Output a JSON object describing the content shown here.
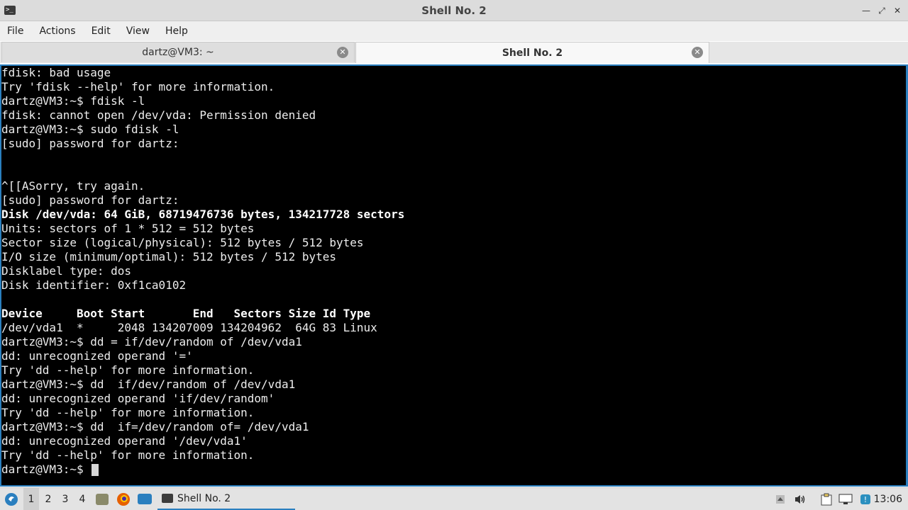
{
  "window": {
    "title": "Shell No. 2",
    "icons": {
      "app": "terminal-icon",
      "minimize": "minimize-icon",
      "maximize": "maximize-icon",
      "close": "close-icon"
    }
  },
  "menu": {
    "items": [
      "File",
      "Actions",
      "Edit",
      "View",
      "Help"
    ]
  },
  "tabs": [
    {
      "label": "dartz@VM3: ~"
    },
    {
      "label": "Shell No. 2"
    }
  ],
  "terminal": {
    "lines": [
      {
        "text": "fdisk: bad usage",
        "bold": false
      },
      {
        "text": "Try 'fdisk --help' for more information.",
        "bold": false
      },
      {
        "text": "dartz@VM3:~$ fdisk -l",
        "bold": false
      },
      {
        "text": "fdisk: cannot open /dev/vda: Permission denied",
        "bold": false
      },
      {
        "text": "dartz@VM3:~$ sudo fdisk -l",
        "bold": false
      },
      {
        "text": "[sudo] password for dartz:",
        "bold": false
      },
      {
        "text": "",
        "bold": false
      },
      {
        "text": "",
        "bold": false
      },
      {
        "text": "^[[ASorry, try again.",
        "bold": false
      },
      {
        "text": "[sudo] password for dartz:",
        "bold": false
      },
      {
        "text": "Disk /dev/vda: 64 GiB, 68719476736 bytes, 134217728 sectors",
        "bold": true
      },
      {
        "text": "Units: sectors of 1 * 512 = 512 bytes",
        "bold": false
      },
      {
        "text": "Sector size (logical/physical): 512 bytes / 512 bytes",
        "bold": false
      },
      {
        "text": "I/O size (minimum/optimal): 512 bytes / 512 bytes",
        "bold": false
      },
      {
        "text": "Disklabel type: dos",
        "bold": false
      },
      {
        "text": "Disk identifier: 0xf1ca0102",
        "bold": false
      },
      {
        "text": "",
        "bold": false
      },
      {
        "text": "Device     Boot Start       End   Sectors Size Id Type",
        "bold": true
      },
      {
        "text": "/dev/vda1  *     2048 134207009 134204962  64G 83 Linux",
        "bold": false
      },
      {
        "text": "dartz@VM3:~$ dd = if/dev/random of /dev/vda1",
        "bold": false
      },
      {
        "text": "dd: unrecognized operand '='",
        "bold": false
      },
      {
        "text": "Try 'dd --help' for more information.",
        "bold": false
      },
      {
        "text": "dartz@VM3:~$ dd  if/dev/random of /dev/vda1",
        "bold": false
      },
      {
        "text": "dd: unrecognized operand 'if/dev/random'",
        "bold": false
      },
      {
        "text": "Try 'dd --help' for more information.",
        "bold": false
      },
      {
        "text": "dartz@VM3:~$ dd  if=/dev/random of= /dev/vda1",
        "bold": false
      },
      {
        "text": "dd: unrecognized operand '/dev/vda1'",
        "bold": false
      },
      {
        "text": "Try 'dd --help' for more information.",
        "bold": false
      }
    ],
    "prompt": "dartz@VM3:~$ "
  },
  "taskbar": {
    "workspaces": [
      "1",
      "2",
      "3",
      "4"
    ],
    "active_workspace": "1",
    "task_label": "Shell No. 2",
    "clock": "13:06",
    "icons": [
      "start-menu-icon",
      "file-manager-icon",
      "firefox-icon",
      "desktop-icon",
      "tray-up-icon",
      "volume-icon",
      "clipboard-icon",
      "network-icon",
      "update-icon"
    ]
  },
  "colors": {
    "accent": "#2a7fbf",
    "terminal_bg": "#000000",
    "terminal_fg": "#ededed"
  }
}
